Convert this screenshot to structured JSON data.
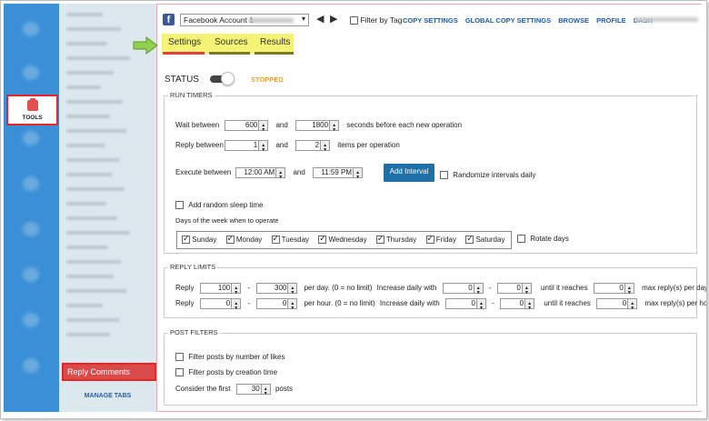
{
  "rail": {
    "tools_label": "TOOLS"
  },
  "sidebar": {
    "active_item": "Reply Comments",
    "manage_tabs": "MANAGE TABS"
  },
  "topbar": {
    "account": "Facebook Account 1",
    "filter_by_tag": "Filter by Tag",
    "links": [
      "COPY SETTINGS",
      "GLOBAL COPY SETTINGS",
      "BROWSE",
      "PROFILE",
      "DASH"
    ]
  },
  "tabs": [
    {
      "label": "Settings",
      "underline": "#e04040"
    },
    {
      "label": "Sources",
      "underline": "#7a7a2a"
    },
    {
      "label": "Results",
      "underline": "#7a7a2a"
    }
  ],
  "status": {
    "label": "STATUS",
    "value": "STOPPED"
  },
  "run_timers": {
    "title": "RUN TIMERS",
    "wait": {
      "label": "Wait between",
      "from": "600",
      "and": "and",
      "to": "1800",
      "suffix": "seconds before each new operation"
    },
    "reply": {
      "label": "Reply between",
      "from": "1",
      "and": "and",
      "to": "2",
      "suffix": "items per operation"
    },
    "execute": {
      "label": "Execute between",
      "from": "12:00 AM",
      "and": "and",
      "to": "11:59 PM",
      "button": "Add Interval",
      "randomize": "Randomize intervals daily"
    },
    "sleep": "Add random sleep time",
    "days_label": "Days of the week when to operate",
    "days": [
      "Sunday",
      "Monday",
      "Tuesday",
      "Wednesday",
      "Thursday",
      "Friday",
      "Saturday"
    ],
    "rotate": "Rotate days"
  },
  "reply_limits": {
    "title": "REPLY LIMITS",
    "day": {
      "label": "Reply",
      "from": "100",
      "dash": "-",
      "to": "300",
      "per": "per day. (0 = no limit)",
      "inc": "Increase daily with",
      "inc_from": "0",
      "inc_to": "0",
      "until": "until it reaches",
      "max": "0",
      "max_label": "max reply(s) per day"
    },
    "hour": {
      "label": "Reply",
      "from": "0",
      "dash": "-",
      "to": "0",
      "per": "per hour. (0 = no limit)",
      "inc": "Increase daily with",
      "inc_from": "0",
      "inc_to": "0",
      "until": "until it reaches",
      "max": "0",
      "max_label": "max reply(s) per hour"
    }
  },
  "post_filters": {
    "title": "POST FILTERS",
    "likes": "Filter posts by number of likes",
    "creation": "Filter posts by creation time",
    "consider": "Consider the first",
    "count": "30",
    "posts": "posts"
  },
  "colors": {
    "rail": "#3a8fd6",
    "highlight": "#e22222",
    "status": "#f0a020",
    "tabs_bg": "#f5f375",
    "link": "#1d5aa8"
  }
}
